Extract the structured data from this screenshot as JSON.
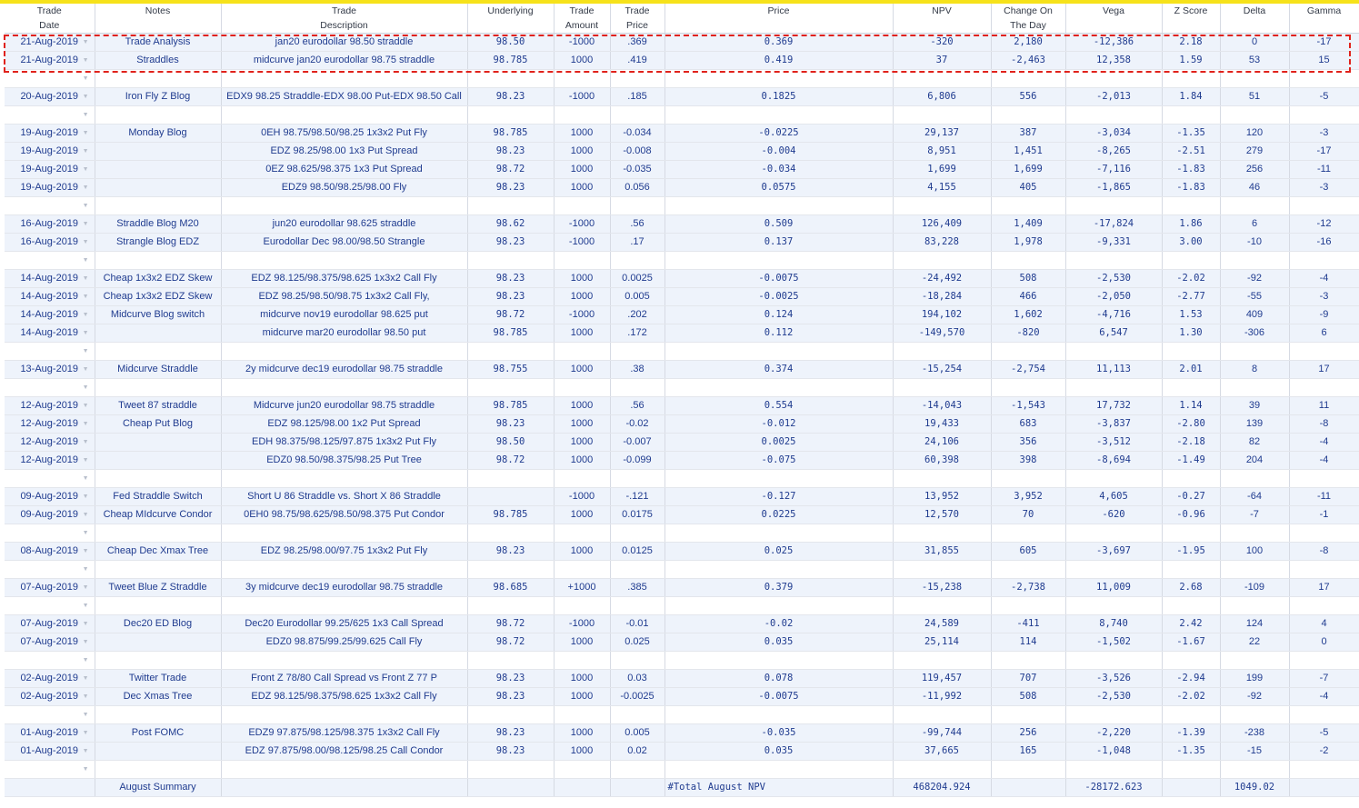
{
  "headers": [
    {
      "l1": "Trade",
      "l2": "Date"
    },
    {
      "l1": "Notes",
      "l2": ""
    },
    {
      "l1": "Trade",
      "l2": "Description"
    },
    {
      "l1": "Underlying",
      "l2": ""
    },
    {
      "l1": "Trade",
      "l2": "Amount"
    },
    {
      "l1": "Trade",
      "l2": "Price"
    },
    {
      "l1": "Price",
      "l2": ""
    },
    {
      "l1": "NPV",
      "l2": ""
    },
    {
      "l1": "Change On",
      "l2": "The Day"
    },
    {
      "l1": "Vega",
      "l2": ""
    },
    {
      "l1": "Z Score",
      "l2": ""
    },
    {
      "l1": "Delta",
      "l2": ""
    },
    {
      "l1": "Gamma",
      "l2": ""
    }
  ],
  "rows": [
    {
      "date": "21-Aug-2019",
      "notes": "Trade Analysis",
      "desc": "jan20 eurodollar 98.50 straddle",
      "und": "98.50",
      "amt": "-1000",
      "tprice": ".369",
      "price": "0.369",
      "npv": "-320",
      "chg": "2,180",
      "vega": "-12,386",
      "z": "2.18",
      "delta": "0",
      "gamma": "-17"
    },
    {
      "date": "21-Aug-2019",
      "notes": "Straddles",
      "desc": "midcurve jan20 eurodollar 98.75 straddle",
      "und": "98.785",
      "amt": "1000",
      "tprice": ".419",
      "price": "0.419",
      "npv": "37",
      "chg": "-2,463",
      "vega": "12,358",
      "z": "1.59",
      "delta": "53",
      "gamma": "15"
    },
    {
      "blank": true
    },
    {
      "date": "20-Aug-2019",
      "notes": "Iron Fly Z Blog",
      "desc": "EDX9 98.25 Straddle-EDX 98.00 Put-EDX 98.50 Call",
      "und": "98.23",
      "amt": "-1000",
      "tprice": ".185",
      "price": "0.1825",
      "npv": "6,806",
      "chg": "556",
      "vega": "-2,013",
      "z": "1.84",
      "delta": "51",
      "gamma": "-5"
    },
    {
      "blank": true
    },
    {
      "date": "19-Aug-2019",
      "notes": "Monday Blog",
      "desc": "0EH 98.75/98.50/98.25 1x3x2 Put Fly",
      "und": "98.785",
      "amt": "1000",
      "tprice": "-0.034",
      "price": "-0.0225",
      "npv": "29,137",
      "chg": "387",
      "vega": "-3,034",
      "z": "-1.35",
      "delta": "120",
      "gamma": "-3"
    },
    {
      "date": "19-Aug-2019",
      "notes": "",
      "desc": "EDZ 98.25/98.00 1x3 Put Spread",
      "und": "98.23",
      "amt": "1000",
      "tprice": "-0.008",
      "price": "-0.004",
      "npv": "8,951",
      "chg": "1,451",
      "vega": "-8,265",
      "z": "-2.51",
      "delta": "279",
      "gamma": "-17"
    },
    {
      "date": "19-Aug-2019",
      "notes": "",
      "desc": "0EZ 98.625/98.375 1x3 Put Spread",
      "und": "98.72",
      "amt": "1000",
      "tprice": "-0.035",
      "price": "-0.034",
      "npv": "1,699",
      "chg": "1,699",
      "vega": "-7,116",
      "z": "-1.83",
      "delta": "256",
      "gamma": "-11"
    },
    {
      "date": "19-Aug-2019",
      "notes": "",
      "desc": "EDZ9 98.50/98.25/98.00 Fly",
      "und": "98.23",
      "amt": "1000",
      "tprice": "0.056",
      "price": "0.0575",
      "npv": "4,155",
      "chg": "405",
      "vega": "-1,865",
      "z": "-1.83",
      "delta": "46",
      "gamma": "-3"
    },
    {
      "blank": true
    },
    {
      "date": "16-Aug-2019",
      "notes": "Straddle Blog M20",
      "desc": "jun20 eurodollar 98.625 straddle",
      "und": "98.62",
      "amt": "-1000",
      "tprice": ".56",
      "price": "0.509",
      "npv": "126,409",
      "chg": "1,409",
      "vega": "-17,824",
      "z": "1.86",
      "delta": "6",
      "gamma": "-12"
    },
    {
      "date": "16-Aug-2019",
      "notes": "Strangle Blog EDZ",
      "desc": "Eurodollar Dec 98.00/98.50 Strangle",
      "und": "98.23",
      "amt": "-1000",
      "tprice": ".17",
      "price": "0.137",
      "npv": "83,228",
      "chg": "1,978",
      "vega": "-9,331",
      "z": "3.00",
      "delta": "-10",
      "gamma": "-16"
    },
    {
      "blank": true
    },
    {
      "date": "14-Aug-2019",
      "notes": "Cheap 1x3x2 EDZ Skew",
      "desc": "EDZ 98.125/98.375/98.625 1x3x2 Call Fly",
      "und": "98.23",
      "amt": "1000",
      "tprice": "0.0025",
      "price": "-0.0075",
      "npv": "-24,492",
      "chg": "508",
      "vega": "-2,530",
      "z": "-2.02",
      "delta": "-92",
      "gamma": "-4"
    },
    {
      "date": "14-Aug-2019",
      "notes": "Cheap 1x3x2 EDZ Skew",
      "desc": "EDZ 98.25/98.50/98.75 1x3x2 Call Fly,",
      "und": "98.23",
      "amt": "1000",
      "tprice": "0.005",
      "price": "-0.0025",
      "npv": "-18,284",
      "chg": "466",
      "vega": "-2,050",
      "z": "-2.77",
      "delta": "-55",
      "gamma": "-3"
    },
    {
      "date": "14-Aug-2019",
      "notes": "Midcurve Blog switch",
      "desc": "midcurve nov19 eurodollar 98.625 put",
      "und": "98.72",
      "amt": "-1000",
      "tprice": ".202",
      "price": "0.124",
      "npv": "194,102",
      "chg": "1,602",
      "vega": "-4,716",
      "z": "1.53",
      "delta": "409",
      "gamma": "-9"
    },
    {
      "date": "14-Aug-2019",
      "notes": "",
      "desc": "midcurve mar20 eurodollar 98.50 put",
      "und": "98.785",
      "amt": "1000",
      "tprice": ".172",
      "price": "0.112",
      "npv": "-149,570",
      "chg": "-820",
      "vega": "6,547",
      "z": "1.30",
      "delta": "-306",
      "gamma": "6"
    },
    {
      "blank": true
    },
    {
      "date": "13-Aug-2019",
      "notes": "Midcurve Straddle",
      "desc": "2y midcurve dec19 eurodollar 98.75 straddle",
      "und": "98.755",
      "amt": "1000",
      "tprice": ".38",
      "price": "0.374",
      "npv": "-15,254",
      "chg": "-2,754",
      "vega": "11,113",
      "z": "2.01",
      "delta": "8",
      "gamma": "17"
    },
    {
      "blank": true
    },
    {
      "date": "12-Aug-2019",
      "notes": "Tweet 87 straddle",
      "desc": "Midcurve jun20 eurodollar 98.75 straddle",
      "und": "98.785",
      "amt": "1000",
      "tprice": ".56",
      "price": "0.554",
      "npv": "-14,043",
      "chg": "-1,543",
      "vega": "17,732",
      "z": "1.14",
      "delta": "39",
      "gamma": "11"
    },
    {
      "date": "12-Aug-2019",
      "notes": "Cheap Put Blog",
      "desc": "EDZ 98.125/98.00 1x2 Put Spread",
      "und": "98.23",
      "amt": "1000",
      "tprice": "-0.02",
      "price": "-0.012",
      "npv": "19,433",
      "chg": "683",
      "vega": "-3,837",
      "z": "-2.80",
      "delta": "139",
      "gamma": "-8"
    },
    {
      "date": "12-Aug-2019",
      "notes": "",
      "desc": "EDH 98.375/98.125/97.875 1x3x2 Put Fly",
      "und": "98.50",
      "amt": "1000",
      "tprice": "-0.007",
      "price": "0.0025",
      "npv": "24,106",
      "chg": "356",
      "vega": "-3,512",
      "z": "-2.18",
      "delta": "82",
      "gamma": "-4"
    },
    {
      "date": "12-Aug-2019",
      "notes": "",
      "desc": "EDZ0 98.50/98.375/98.25 Put Tree",
      "und": "98.72",
      "amt": "1000",
      "tprice": "-0.099",
      "price": "-0.075",
      "npv": "60,398",
      "chg": "398",
      "vega": "-8,694",
      "z": "-1.49",
      "delta": "204",
      "gamma": "-4"
    },
    {
      "blank": true
    },
    {
      "date": "09-Aug-2019",
      "notes": "Fed Straddle Switch",
      "desc": "Short U 86 Straddle vs. Short X 86 Straddle",
      "und": "",
      "amt": "-1000",
      "tprice": "-.121",
      "price": "-0.127",
      "npv": "13,952",
      "chg": "3,952",
      "vega": "4,605",
      "z": "-0.27",
      "delta": "-64",
      "gamma": "-11"
    },
    {
      "date": "09-Aug-2019",
      "notes": "Cheap MIdcurve Condor",
      "desc": "0EH0 98.75/98.625/98.50/98.375 Put Condor",
      "und": "98.785",
      "amt": "1000",
      "tprice": "0.0175",
      "price": "0.0225",
      "npv": "12,570",
      "chg": "70",
      "vega": "-620",
      "z": "-0.96",
      "delta": "-7",
      "gamma": "-1"
    },
    {
      "blank": true
    },
    {
      "date": "08-Aug-2019",
      "notes": "Cheap Dec Xmax Tree",
      "desc": "EDZ 98.25/98.00/97.75 1x3x2 Put Fly",
      "und": "98.23",
      "amt": "1000",
      "tprice": "0.0125",
      "price": "0.025",
      "npv": "31,855",
      "chg": "605",
      "vega": "-3,697",
      "z": "-1.95",
      "delta": "100",
      "gamma": "-8"
    },
    {
      "blank": true
    },
    {
      "date": "07-Aug-2019",
      "notes": "Tweet Blue Z Straddle",
      "desc": "3y midcurve dec19 eurodollar 98.75 straddle",
      "und": "98.685",
      "amt": "+1000",
      "tprice": ".385",
      "price": "0.379",
      "npv": "-15,238",
      "chg": "-2,738",
      "vega": "11,009",
      "z": "2.68",
      "delta": "-109",
      "gamma": "17"
    },
    {
      "blank": true
    },
    {
      "date": "07-Aug-2019",
      "notes": "Dec20 ED Blog",
      "desc": "Dec20 Eurodollar 99.25/625 1x3 Call Spread",
      "und": "98.72",
      "amt": "-1000",
      "tprice": "-0.01",
      "price": "-0.02",
      "npv": "24,589",
      "chg": "-411",
      "vega": "8,740",
      "z": "2.42",
      "delta": "124",
      "gamma": "4"
    },
    {
      "date": "07-Aug-2019",
      "notes": "",
      "desc": "EDZ0 98.875/99.25/99.625 Call Fly",
      "und": "98.72",
      "amt": "1000",
      "tprice": "0.025",
      "price": "0.035",
      "npv": "25,114",
      "chg": "114",
      "vega": "-1,502",
      "z": "-1.67",
      "delta": "22",
      "gamma": "0"
    },
    {
      "blank": true
    },
    {
      "date": "02-Aug-2019",
      "notes": "Twitter Trade",
      "desc": "Front Z 78/80 Call Spread vs Front Z 77 P",
      "und": "98.23",
      "amt": "1000",
      "tprice": "0.03",
      "price": "0.078",
      "npv": "119,457",
      "chg": "707",
      "vega": "-3,526",
      "z": "-2.94",
      "delta": "199",
      "gamma": "-7"
    },
    {
      "date": "02-Aug-2019",
      "notes": "Dec Xmas Tree",
      "desc": "EDZ 98.125/98.375/98.625 1x3x2 Call Fly",
      "und": "98.23",
      "amt": "1000",
      "tprice": "-0.0025",
      "price": "-0.0075",
      "npv": "-11,992",
      "chg": "508",
      "vega": "-2,530",
      "z": "-2.02",
      "delta": "-92",
      "gamma": "-4"
    },
    {
      "blank": true
    },
    {
      "date": "01-Aug-2019",
      "notes": "Post FOMC",
      "desc": "EDZ9 97.875/98.125/98.375 1x3x2 Call Fly",
      "und": "98.23",
      "amt": "1000",
      "tprice": "0.005",
      "price": "-0.035",
      "npv": "-99,744",
      "chg": "256",
      "vega": "-2,220",
      "z": "-1.39",
      "delta": "-238",
      "gamma": "-5"
    },
    {
      "date": "01-Aug-2019",
      "notes": "",
      "desc": "EDZ 97.875/98.00/98.125/98.25 Call Condor",
      "und": "98.23",
      "amt": "1000",
      "tprice": "0.02",
      "price": "0.035",
      "npv": "37,665",
      "chg": "165",
      "vega": "-1,048",
      "z": "-1.35",
      "delta": "-15",
      "gamma": "-2"
    },
    {
      "blank": true
    }
  ],
  "summary": {
    "notes": "August Summary",
    "price": "#Total August NPV",
    "npv": "468204.924",
    "vega": "-28172.623",
    "delta": "1049.02"
  },
  "colors": {
    "highlight": "#e0221c",
    "topbar": "#f6e21a",
    "row_bg": "#eef3fb",
    "text": "#1f3b8f"
  }
}
